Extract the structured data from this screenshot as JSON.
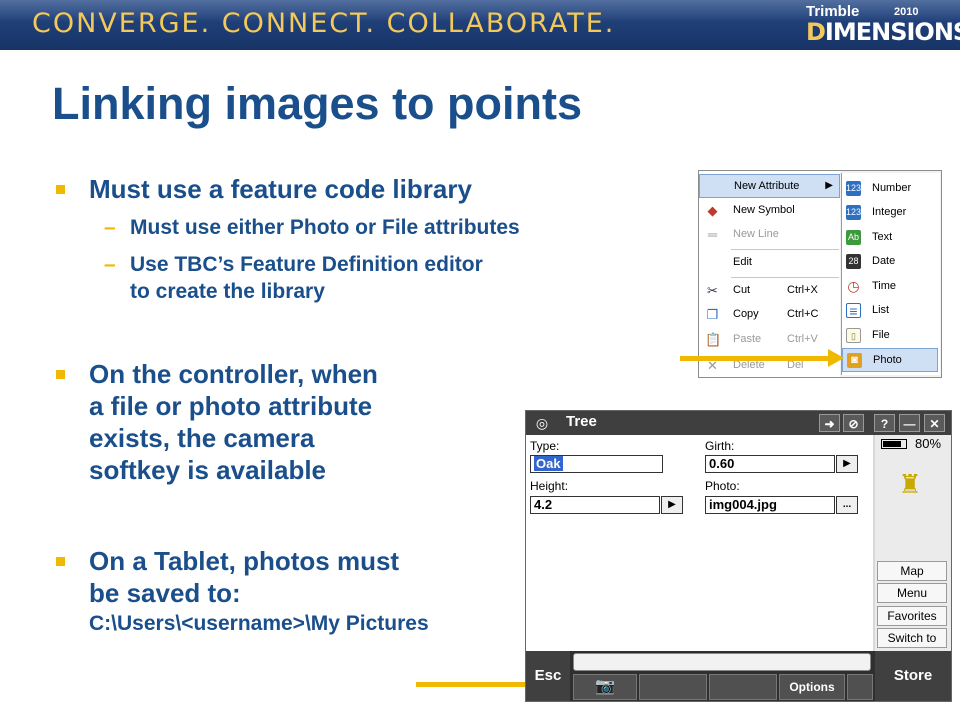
{
  "banner": {
    "tagline": "CONVERGE. CONNECT. COLLABORATE.",
    "brand_top": "Trimble",
    "brand_year": "2010",
    "brand_main_first": "D",
    "brand_main_rest": "IMENSIONS"
  },
  "slide": {
    "title": "Linking images to points",
    "bullets": [
      {
        "text": "Must use a feature code library",
        "subs": [
          "Must use either Photo or File attributes",
          "Use TBC’s Feature Definition editor",
          "to create the library"
        ]
      },
      {
        "lines": [
          "On the controller, when",
          "a file or photo attribute",
          "exists, the camera",
          "softkey is available"
        ]
      },
      {
        "lines": [
          "On a Tablet, photos must",
          "be saved to:",
          "C:\\Users\\<username>\\My Pictures"
        ]
      }
    ]
  },
  "context_menu": {
    "items": [
      {
        "label": "New Attribute",
        "icon": "attribute-icon",
        "glyph": "",
        "state": "highlighted"
      },
      {
        "label": "New Symbol",
        "icon": "symbol-icon",
        "glyph": "◆"
      },
      {
        "label": "New Line",
        "icon": "line-icon",
        "glyph": "═",
        "state": "disabled"
      },
      {
        "label": "Edit",
        "icon": "",
        "glyph": ""
      },
      {
        "label": "Cut",
        "shortcut": "Ctrl+X",
        "icon": "scissors-icon",
        "glyph": "✂"
      },
      {
        "label": "Copy",
        "shortcut": "Ctrl+C",
        "icon": "copy-icon",
        "glyph": "❐"
      },
      {
        "label": "Paste",
        "shortcut": "Ctrl+V",
        "icon": "paste-icon",
        "glyph": "📋",
        "state": "disabled"
      },
      {
        "label": "Delete",
        "shortcut": "Del",
        "icon": "delete-icon",
        "glyph": "✕",
        "state": "disabled"
      }
    ],
    "submenu": [
      {
        "label": "Number",
        "glyph": "123"
      },
      {
        "label": "Integer",
        "glyph": "123"
      },
      {
        "label": "Text",
        "glyph": "Ab"
      },
      {
        "label": "Date",
        "glyph": "28"
      },
      {
        "label": "Time",
        "glyph": "◷"
      },
      {
        "label": "List",
        "glyph": "≡"
      },
      {
        "label": "File",
        "glyph": "▯"
      },
      {
        "label": "Photo",
        "glyph": "◙",
        "state": "highlighted"
      }
    ]
  },
  "controller": {
    "title": "Tree",
    "toolbar": [
      "➜",
      "⊘",
      "?",
      "—",
      "✕"
    ],
    "fields": {
      "type_label": "Type:",
      "type_value": "Oak",
      "girth_label": "Girth:",
      "girth_value": "0.60",
      "height_label": "Height:",
      "height_value": "4.2",
      "photo_label": "Photo:",
      "photo_value": "img004.jpg",
      "browse_label": "...",
      "next_glyph": "▶"
    },
    "battery_percent": "80%",
    "battery_level": 0.8,
    "side_buttons": [
      "Map",
      "Menu",
      "Favorites",
      "Switch to"
    ],
    "esc_label": "Esc",
    "softkeys": {
      "camera": "📷",
      "options": "Options"
    },
    "store_label": "Store"
  },
  "colors": {
    "accent": "#f0b800",
    "title_blue": "#1a4f8b",
    "banner_blue": "#1f3f78"
  }
}
